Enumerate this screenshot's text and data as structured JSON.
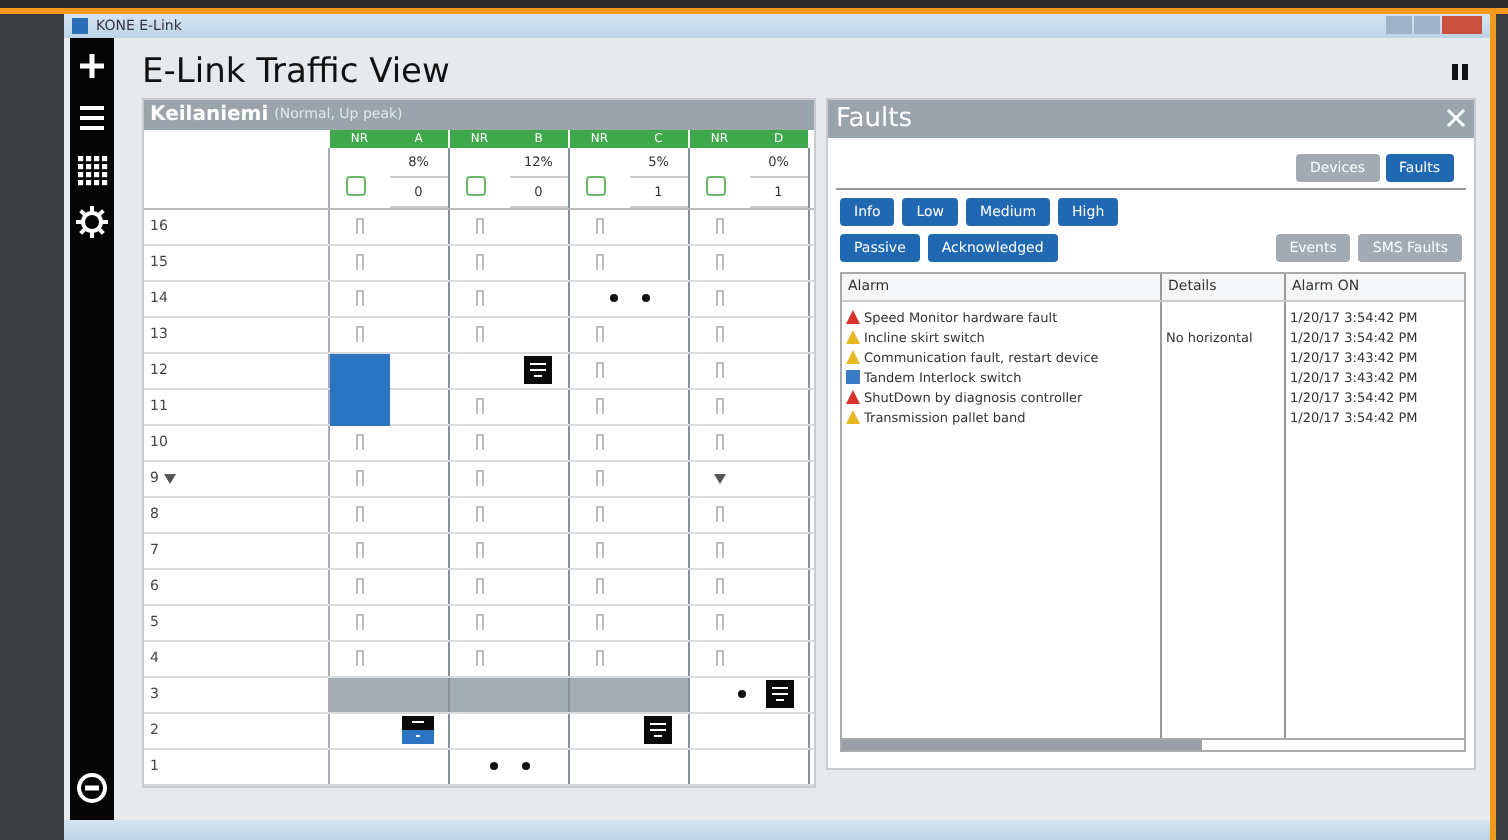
{
  "window": {
    "title": "KONE E-Link"
  },
  "header": {
    "title": "E-Link Traffic View"
  },
  "traffic": {
    "site": "Keilaniemi",
    "mode": "(Normal, Up peak)",
    "elevators": [
      {
        "group": "NR",
        "name": "A",
        "load": "8%",
        "count": "0"
      },
      {
        "group": "NR",
        "name": "B",
        "load": "12%",
        "count": "0"
      },
      {
        "group": "NR",
        "name": "C",
        "load": "5%",
        "count": "1"
      },
      {
        "group": "NR",
        "name": "D",
        "load": "0%",
        "count": "1"
      }
    ],
    "rows": [
      {
        "floor": "16",
        "landing_call": false,
        "cells": [
          {
            "kind": "door"
          },
          {
            "kind": "door"
          },
          {
            "kind": "door"
          },
          {
            "kind": "door"
          }
        ]
      },
      {
        "floor": "15",
        "landing_call": false,
        "cells": [
          {
            "kind": "door"
          },
          {
            "kind": "door"
          },
          {
            "kind": "door"
          },
          {
            "kind": "door"
          }
        ]
      },
      {
        "floor": "14",
        "landing_call": false,
        "cells": [
          {
            "kind": "door"
          },
          {
            "kind": "door"
          },
          {
            "kind": "calls"
          },
          {
            "kind": "door"
          }
        ]
      },
      {
        "floor": "13",
        "landing_call": false,
        "cells": [
          {
            "kind": "door"
          },
          {
            "kind": "door"
          },
          {
            "kind": "door"
          },
          {
            "kind": "door"
          }
        ]
      },
      {
        "floor": "12",
        "landing_call": false,
        "cells": [
          {
            "kind": "highlight"
          },
          {
            "kind": "car"
          },
          {
            "kind": "door"
          },
          {
            "kind": "door"
          }
        ]
      },
      {
        "floor": "11",
        "landing_call": false,
        "cells": [
          {
            "kind": "highlight"
          },
          {
            "kind": "door"
          },
          {
            "kind": "door"
          },
          {
            "kind": "door"
          }
        ]
      },
      {
        "floor": "10",
        "landing_call": false,
        "cells": [
          {
            "kind": "door"
          },
          {
            "kind": "door"
          },
          {
            "kind": "door"
          },
          {
            "kind": "door"
          }
        ]
      },
      {
        "floor": "9",
        "landing_call": true,
        "cells": [
          {
            "kind": "door"
          },
          {
            "kind": "door"
          },
          {
            "kind": "door"
          },
          {
            "kind": "down_call"
          }
        ]
      },
      {
        "floor": "8",
        "landing_call": false,
        "cells": [
          {
            "kind": "door"
          },
          {
            "kind": "door"
          },
          {
            "kind": "door"
          },
          {
            "kind": "door"
          }
        ]
      },
      {
        "floor": "7",
        "landing_call": false,
        "cells": [
          {
            "kind": "door"
          },
          {
            "kind": "door"
          },
          {
            "kind": "door"
          },
          {
            "kind": "door"
          }
        ]
      },
      {
        "floor": "6",
        "landing_call": false,
        "cells": [
          {
            "kind": "door"
          },
          {
            "kind": "door"
          },
          {
            "kind": "door"
          },
          {
            "kind": "door"
          }
        ]
      },
      {
        "floor": "5",
        "landing_call": false,
        "cells": [
          {
            "kind": "door"
          },
          {
            "kind": "door"
          },
          {
            "kind": "door"
          },
          {
            "kind": "door"
          }
        ]
      },
      {
        "floor": "4",
        "landing_call": false,
        "cells": [
          {
            "kind": "door"
          },
          {
            "kind": "door"
          },
          {
            "kind": "door"
          },
          {
            "kind": "door"
          }
        ]
      },
      {
        "floor": "3",
        "landing_call": false,
        "cells": [
          {
            "kind": "blocked"
          },
          {
            "kind": "blocked"
          },
          {
            "kind": "blocked"
          },
          {
            "kind": "car_call"
          }
        ]
      },
      {
        "floor": "2",
        "landing_call": false,
        "cells": [
          {
            "kind": "car_blue"
          },
          {
            "kind": "empty"
          },
          {
            "kind": "car"
          },
          {
            "kind": "empty"
          }
        ]
      },
      {
        "floor": "1",
        "landing_call": false,
        "cells": [
          {
            "kind": "empty"
          },
          {
            "kind": "calls"
          },
          {
            "kind": "empty"
          },
          {
            "kind": "empty"
          }
        ]
      }
    ]
  },
  "faults": {
    "title": "Faults",
    "tabs": [
      {
        "label": "Devices",
        "selected": false
      },
      {
        "label": "Faults",
        "selected": true
      }
    ],
    "filters": [
      {
        "label": "Info",
        "on": true
      },
      {
        "label": "Low",
        "on": true
      },
      {
        "label": "Medium",
        "on": true
      },
      {
        "label": "High",
        "on": true
      }
    ],
    "filters_2": [
      {
        "label": "Passive",
        "on": true
      },
      {
        "label": "Acknowledged",
        "on": true
      }
    ],
    "views": [
      {
        "label": "Events",
        "on": false
      },
      {
        "label": "SMS Faults",
        "on": false
      }
    ],
    "columns": [
      "Alarm",
      "Details",
      "Alarm ON"
    ],
    "rows": [
      {
        "kind": "high",
        "alarm": "Speed Monitor hardware fault",
        "details": "",
        "time": "1/20/17 3:54:42 PM"
      },
      {
        "kind": "warning",
        "alarm": "Incline skirt switch",
        "details": "No horizontal",
        "time": "1/20/17 3:54:42 PM"
      },
      {
        "kind": "warning",
        "alarm": "Communication fault, restart device",
        "details": "",
        "time": "1/20/17 3:43:42 PM"
      },
      {
        "kind": "info",
        "alarm": "Tandem Interlock switch",
        "details": "",
        "time": "1/20/17 3:43:42 PM"
      },
      {
        "kind": "high",
        "alarm": "ShutDown by diagnosis controller",
        "details": "",
        "time": "1/20/17 3:54:42 PM"
      },
      {
        "kind": "warning",
        "alarm": "Transmission pallet band",
        "details": "",
        "time": "1/20/17 3:54:42 PM"
      }
    ]
  }
}
